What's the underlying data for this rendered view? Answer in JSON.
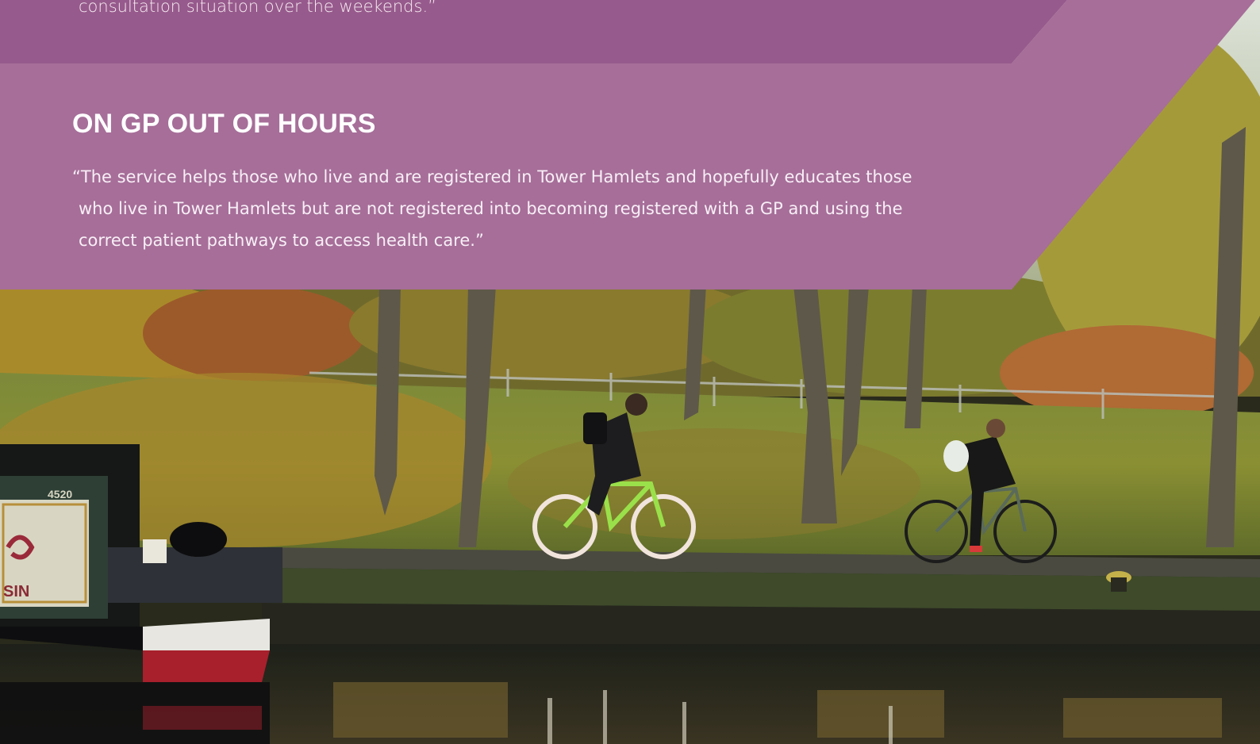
{
  "colors": {
    "band_dark": "#975a8c",
    "band_main": "#a66e99",
    "text": "#ffffff"
  },
  "top_quote": {
    "line": "consultation situation over the weekends.”"
  },
  "section": {
    "heading": "ON GP OUT OF HOURS",
    "quote_lines": [
      "“The service helps those who live and are registered in Tower Hamlets and hopefully educates those",
      "who live in Tower Hamlets but are not registered into becoming registered with a GP and using the",
      "correct patient pathways to access health care.”"
    ]
  },
  "photo": {
    "boat_sign": "SIN",
    "boat_number": "4520"
  }
}
